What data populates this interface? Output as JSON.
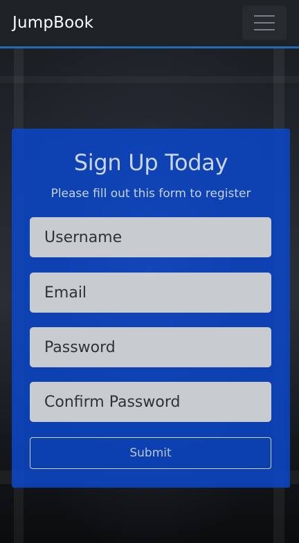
{
  "navbar": {
    "brand": "JumpBook",
    "menu_icon": "hamburger-menu-icon"
  },
  "form": {
    "title": "Sign Up Today",
    "subtitle": "Please fill out this form to register",
    "fields": [
      {
        "placeholder": "Username",
        "value": ""
      },
      {
        "placeholder": "Email",
        "value": ""
      },
      {
        "placeholder": "Password",
        "value": ""
      },
      {
        "placeholder": "Confirm Password",
        "value": ""
      }
    ],
    "submit_label": "Submit"
  },
  "colors": {
    "navbar_bg": "#1d2226",
    "navbar_accent": "#1f6fb8",
    "card_bg": "#0a46c8",
    "field_bg": "#c8cbd0"
  }
}
